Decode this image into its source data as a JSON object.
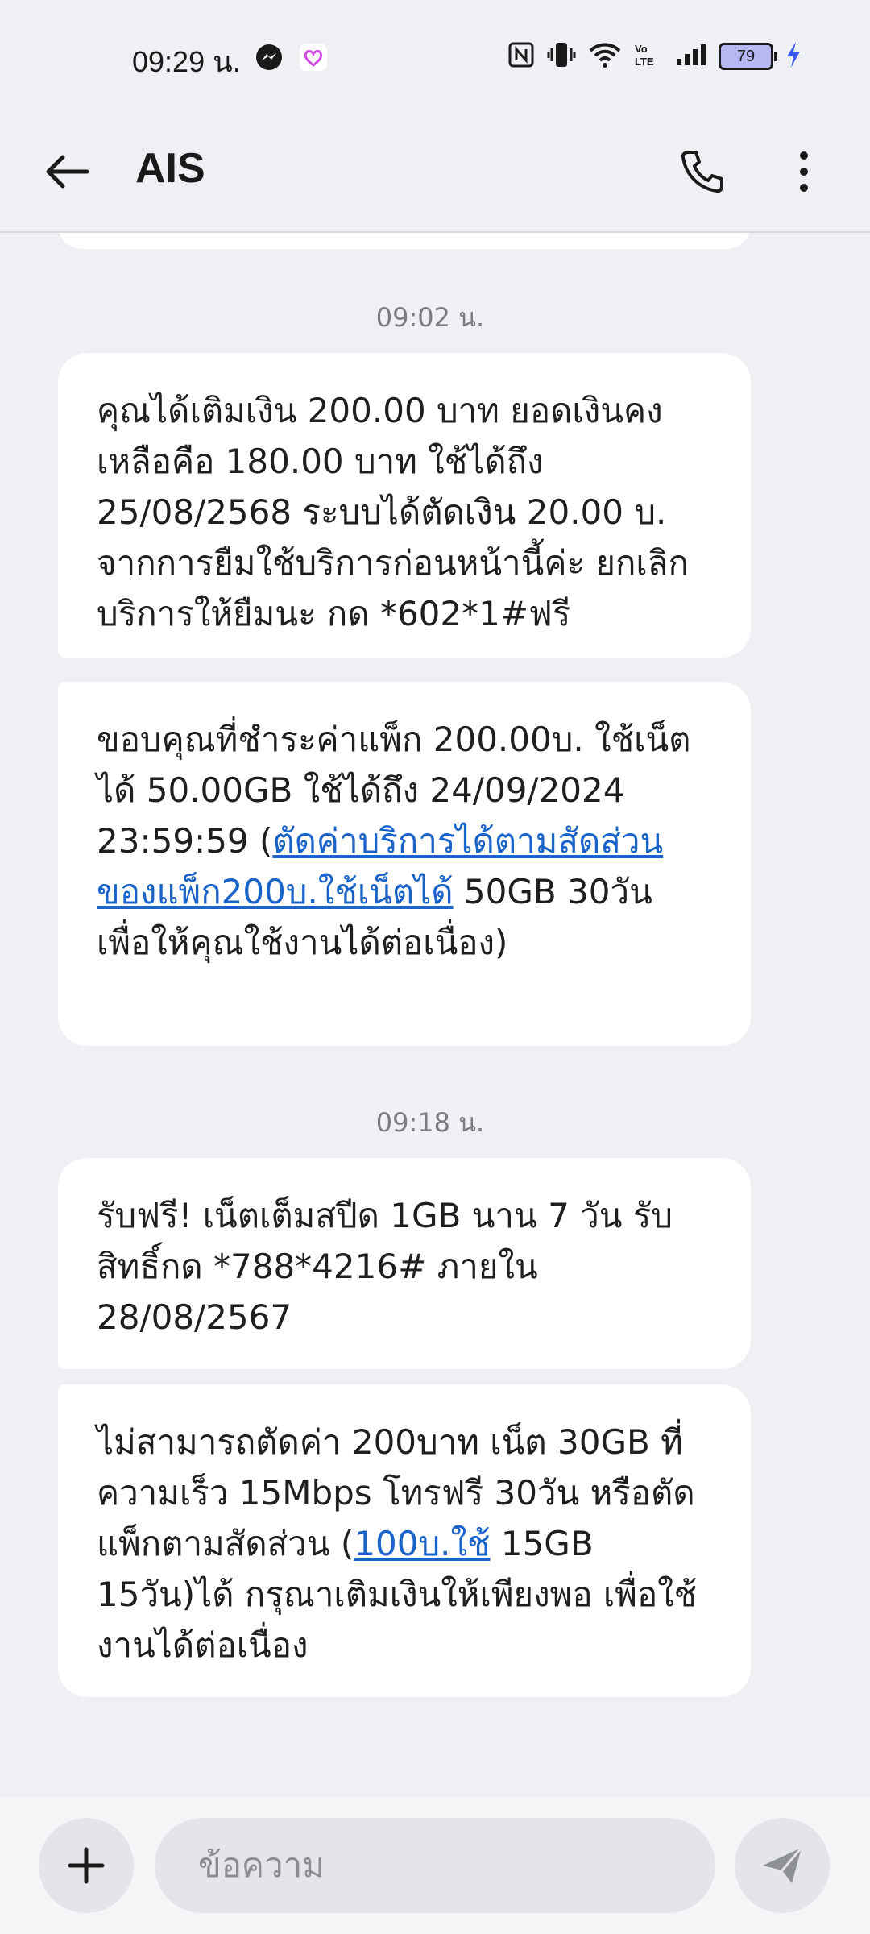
{
  "status_bar": {
    "time": "09:29 น.",
    "battery": "79"
  },
  "app_bar": {
    "title": "AIS"
  },
  "thread": {
    "messages_group_1_time": "09:02 น.",
    "message_1": "คุณได้เติมเงิน 200.00 บาท ยอดเงินคงเหลือคือ 180.00 บาท ใช้ได้ถึง 25/08/2568 ระบบได้ตัดเงิน 20.00 บ. จากการยืมใช้บริการก่อนหน้านี้ค่ะ ยกเลิกบริการให้ยืมนะ กด *602*1#ฟรี",
    "message_2_pre": "ขอบคุณที่ชำระค่าแพ็ก 200.00บ. ใช้เน็ตได้ 50.00GB ใช้ได้ถึง 24/09/2024 23:59:59 (",
    "message_2_link": "ตัดค่าบริการได้ตามสัดส่วนของแพ็ก200บ.ใช้เน็ตได้",
    "message_2_post": " 50GB 30วัน เพื่อให้คุณใช้งานได้ต่อเนื่อง)",
    "messages_group_2_time": "09:18 น.",
    "message_3": "รับฟรี! เน็ตเต็มสปีด 1GB นาน 7 วัน รับสิทธิ์กด *788*4216# ภายใน 28/08/2567",
    "message_4_pre": "ไม่สามารถตัดค่า 200บาท เน็ต 30GB ที่ความเร็ว 15Mbps โทรฟรี 30วัน หรือตัดแพ็กตามสัดส่วน (",
    "message_4_link": "100บ.ใช้",
    "message_4_post": " 15GB 15วัน)ได้ กรุณาเติมเงินให้เพียงพอ เพื่อใช้งานได้ต่อเนื่อง"
  },
  "composer": {
    "placeholder": "ข้อความ"
  }
}
